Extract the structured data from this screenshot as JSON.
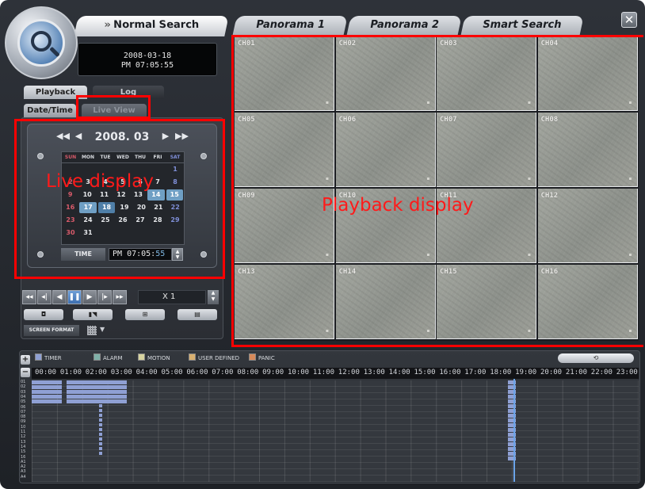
{
  "tabs": {
    "normal": "Normal Search",
    "panorama1": "Panorama 1",
    "panorama2": "Panorama 2",
    "smart": "Smart Search"
  },
  "close_label": "✕",
  "clock": {
    "date": "2008-03-18",
    "time": "PM 07:05:55"
  },
  "subtabs": {
    "playback": "Playback",
    "log": "Log",
    "datetime": "Date/Time",
    "liveview": "Live View"
  },
  "calendar": {
    "month": "2008. 03",
    "days_of_week": [
      "SUN",
      "MON",
      "TUE",
      "WED",
      "THU",
      "FRI",
      "SAT"
    ],
    "weeks": [
      [
        "",
        "",
        "",
        "",
        "",
        "",
        "1"
      ],
      [
        "2",
        "3",
        "4",
        "5",
        "6",
        "7",
        "8"
      ],
      [
        "9",
        "10",
        "11",
        "12",
        "13",
        "14",
        "15"
      ],
      [
        "16",
        "17",
        "18",
        "19",
        "20",
        "21",
        "22"
      ],
      [
        "23",
        "24",
        "25",
        "26",
        "27",
        "28",
        "29"
      ],
      [
        "30",
        "31",
        "",
        "",
        "",
        "",
        ""
      ]
    ],
    "highlighted_days": [
      "14",
      "15",
      "17"
    ],
    "selected_day": "18"
  },
  "time": {
    "label": "TIME",
    "ampm": "PM",
    "hhmm": "07:05:",
    "ss": "55"
  },
  "playback": {
    "buttons": [
      "◂◂",
      "◂|",
      "◀",
      "❚❚",
      "▶",
      "|▸",
      "▸▸"
    ],
    "active_index": 3,
    "speed": "X 1"
  },
  "screen_format_label": "SCREEN FORMAT",
  "channels": [
    "CH01",
    "CH02",
    "CH03",
    "CH04",
    "CH05",
    "CH06",
    "CH07",
    "CH08",
    "CH09",
    "CH10",
    "CH11",
    "CH12",
    "CH13",
    "CH14",
    "CH15",
    "CH16"
  ],
  "annotations": {
    "live": "Live display",
    "playback": "Playback display"
  },
  "legend": [
    {
      "label": "TIMER",
      "color": "#8fa0d4"
    },
    {
      "label": "ALARM",
      "color": "#7fb0a8"
    },
    {
      "label": "MOTION",
      "color": "#d8d4a0"
    },
    {
      "label": "USER DEFINED",
      "color": "#d8b070"
    },
    {
      "label": "PANIC",
      "color": "#d88a5a"
    }
  ],
  "hours": [
    "00:00",
    "01:00",
    "02:00",
    "03:00",
    "04:00",
    "05:00",
    "06:00",
    "07:00",
    "08:00",
    "09:00",
    "10:00",
    "11:00",
    "12:00",
    "13:00",
    "14:00",
    "15:00",
    "16:00",
    "17:00",
    "18:00",
    "19:00",
    "20:00",
    "21:00",
    "22:00",
    "23:00"
  ],
  "track_labels": [
    "01",
    "02",
    "03",
    "04",
    "05",
    "06",
    "07",
    "08",
    "09",
    "10",
    "11",
    "12",
    "13",
    "14",
    "15",
    "16",
    "A1",
    "A2",
    "A3",
    "A4"
  ]
}
